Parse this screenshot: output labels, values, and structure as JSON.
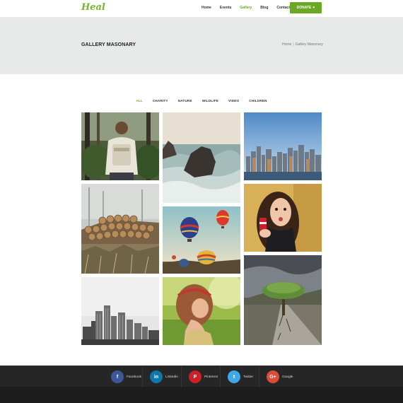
{
  "header": {
    "logo": "Heal",
    "nav": [
      "Home",
      "Events",
      "Gallery",
      "Blog",
      "Contact"
    ],
    "active_nav": "Gallery",
    "donate_label": "DONATE",
    "accent_color": "#6aa825"
  },
  "banner": {
    "title": "GALLERY MASONARY",
    "breadcrumb": {
      "home": "Home",
      "separator": "|",
      "current": "Gallery Masonary"
    }
  },
  "filters": {
    "items": [
      "ALL",
      "CHARITY",
      "NATURE",
      "WILDLIFE",
      "VIDEO",
      "CHILDREN"
    ],
    "active": "ALL"
  },
  "gallery": {
    "images": [
      "hiker-in-forest",
      "rock-in-sea-waves",
      "city-skyline",
      "stacked-logs-in-fog",
      "hot-air-balloons",
      "woman-with-soda-can",
      "grayscale-skyscrapers",
      "girl-with-headband-in-field",
      "tree-on-cracked-road"
    ]
  },
  "footer": {
    "socials": [
      {
        "label": "Facebook",
        "glyph": "f",
        "color": "#3b5998",
        "icon": "facebook-icon"
      },
      {
        "label": "Linkedin",
        "glyph": "in",
        "color": "#0e76a8",
        "icon": "linkedin-icon"
      },
      {
        "label": "Pinterest",
        "glyph": "P",
        "color": "#cb2027",
        "icon": "pinterest-icon"
      },
      {
        "label": "Twitter",
        "glyph": "t",
        "color": "#3fa9e6",
        "icon": "twitter-icon"
      },
      {
        "label": "Google",
        "glyph": "G+",
        "color": "#dd4b39",
        "icon": "google-plus-icon"
      }
    ]
  }
}
